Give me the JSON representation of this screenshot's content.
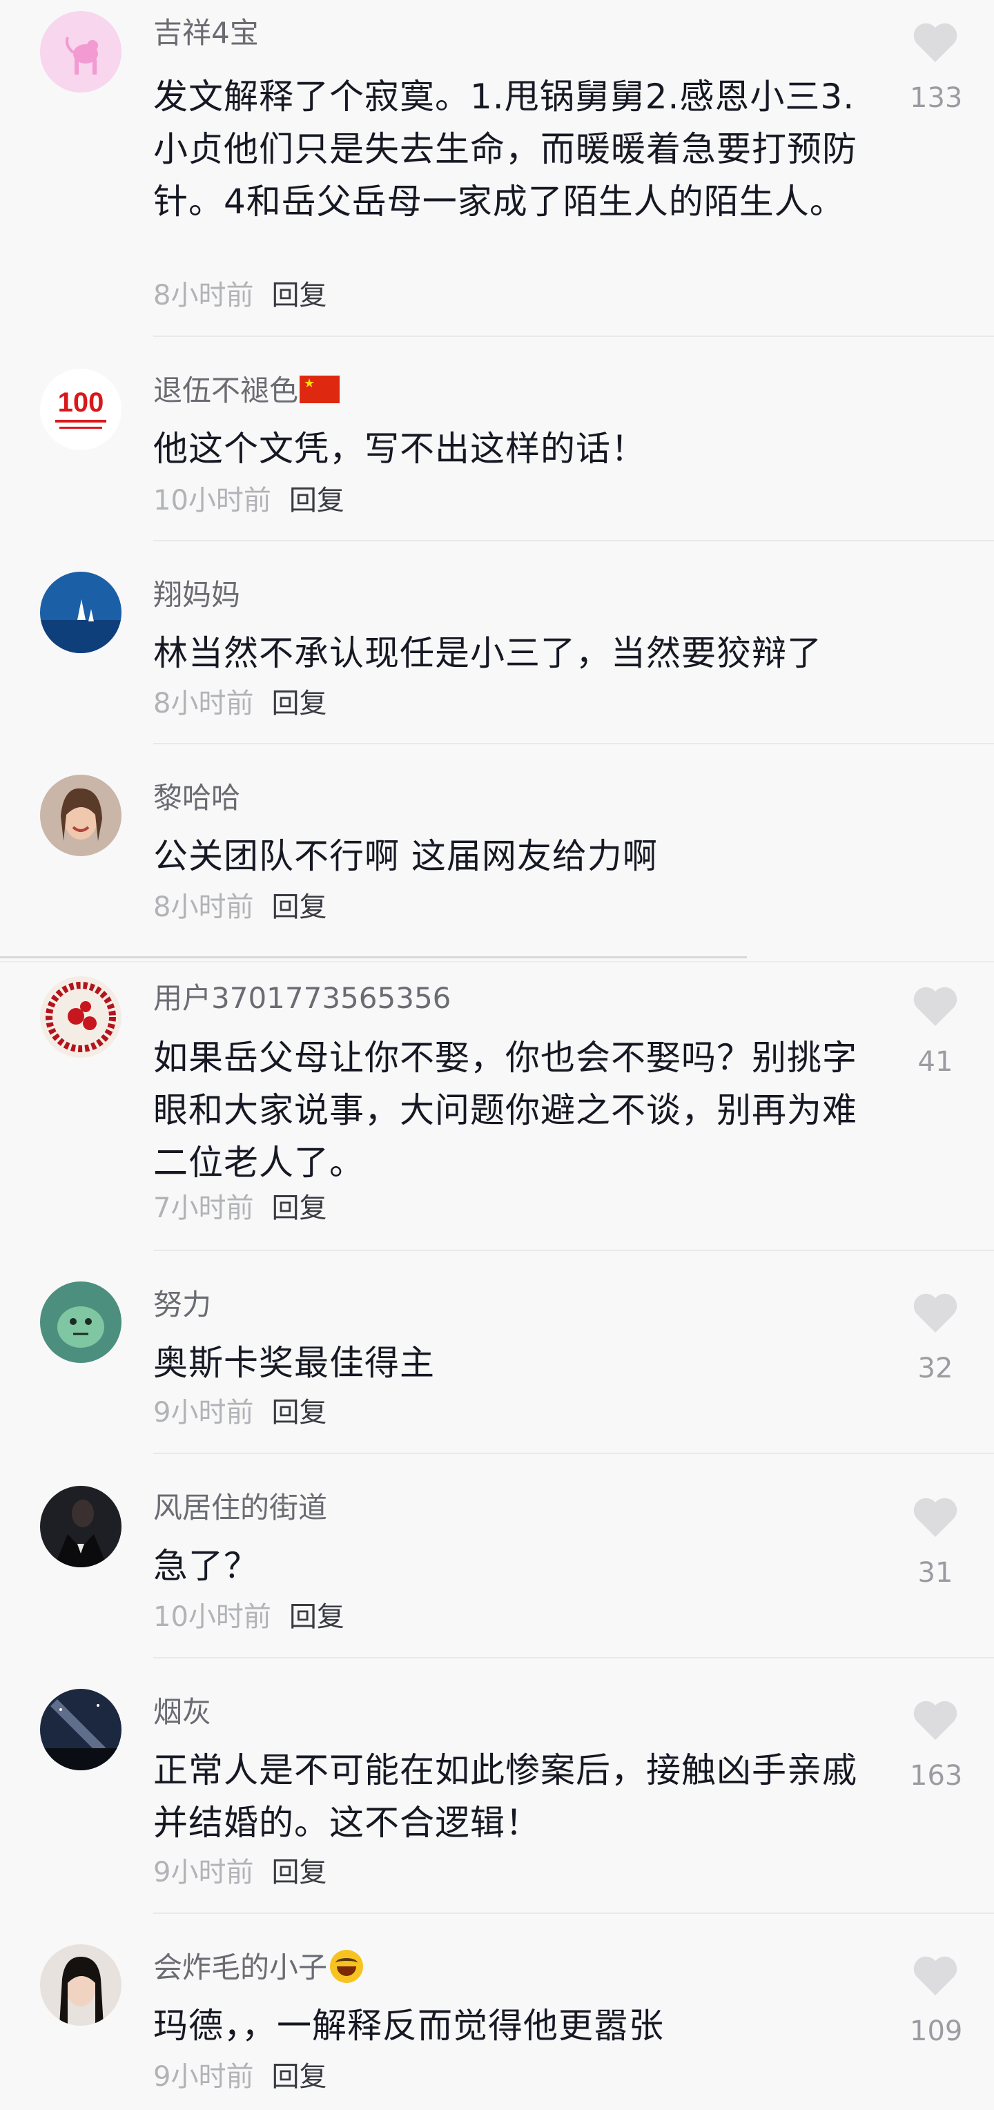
{
  "reply_label": "回复",
  "colors": {
    "text": "#161823",
    "secondary": "#b2b3b7",
    "like_icon": "#dcdcde",
    "background": "#f8f8f8"
  },
  "comments": [
    {
      "username": "吉祥4宝",
      "avatar": "pink-panther-avatar",
      "text": "发文解释了个寂寞。1.甩锅舅舅2.感恩小三3.小贞他们只是失去生命，而暖暖着急要打预防针。4和岳父岳母一家成了陌生人的陌生人。",
      "time": "8小时前",
      "likes": "133"
    },
    {
      "username": "退伍不褪色",
      "avatar": "party-100-anniversary-avatar",
      "text": "他这个文凭，写不出这样的话！",
      "time": "10小时前",
      "likes": ""
    },
    {
      "username": "翔妈妈",
      "avatar": "sailboats-sea-avatar",
      "text": "林当然不承认现任是小三了，当然要狡辩了",
      "time": "8小时前",
      "likes": ""
    },
    {
      "username": "黎哈哈",
      "avatar": "smiling-woman-avatar",
      "text": "公关团队不行啊 这届网友给力啊",
      "time": "8小时前",
      "likes": ""
    },
    {
      "username": "用户3701773565356",
      "avatar": "red-beads-avatar",
      "text": "如果岳父母让你不娶，你也会不娶吗？别挑字眼和大家说事，大问题你避之不谈，别再为难二位老人了。",
      "time": "7小时前",
      "likes": "41"
    },
    {
      "username": "努力",
      "avatar": "green-cartoon-avatar",
      "text": "奥斯卡奖最佳得主",
      "time": "9小时前",
      "likes": "32"
    },
    {
      "username": "风居住的街道",
      "avatar": "man-in-suit-avatar",
      "text": "急了？",
      "time": "10小时前",
      "likes": "31"
    },
    {
      "username": "烟灰",
      "avatar": "night-sky-avatar",
      "text": "正常人是不可能在如此惨案后，接触凶手亲戚并结婚的。这不合逻辑！",
      "time": "9小时前",
      "likes": "163"
    },
    {
      "username": "会炸毛的小子",
      "avatar": "woman-portrait-avatar",
      "text": "玛德，，一解释反而觉得他更嚣张",
      "time": "9小时前",
      "likes": "109"
    }
  ]
}
